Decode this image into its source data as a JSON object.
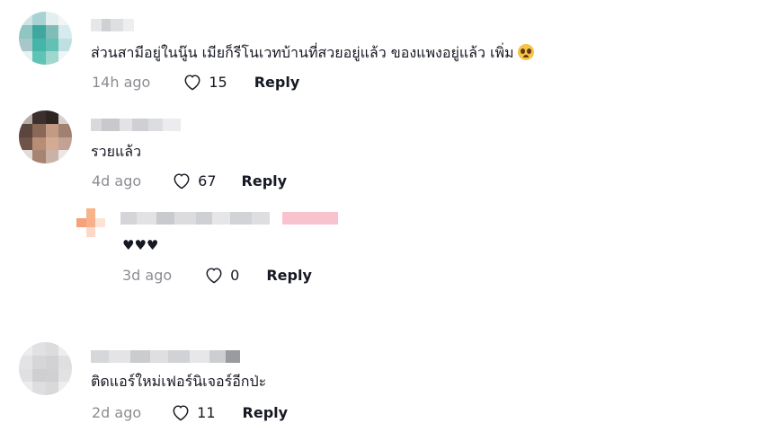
{
  "comments": [
    {
      "text": "ส่วนสามีอยู่ในนู๊น เมียก็รีโนเวทบ้านที่สวยอยู่แล้ว ของแพงอยู่แล้ว เพิ่ม",
      "emoji": "pleading-face-emoji",
      "time": "14h ago",
      "likes": "15",
      "reply_label": "Reply"
    },
    {
      "text": "รวยแล้ว",
      "time": "4d ago",
      "likes": "67",
      "reply_label": "Reply"
    },
    {
      "text": "♥♥♥",
      "time": "3d ago",
      "likes": "0",
      "reply_label": "Reply"
    },
    {
      "text": "ติดแอร์ใหม่เฟอร์นิเจอร์อีกป่ะ",
      "time": "2d ago",
      "likes": "11",
      "reply_label": "Reply"
    }
  ],
  "colors": {
    "text": "#161823",
    "secondary": "#8a8b91"
  },
  "icons": {
    "like": "heart-outline-icon"
  }
}
